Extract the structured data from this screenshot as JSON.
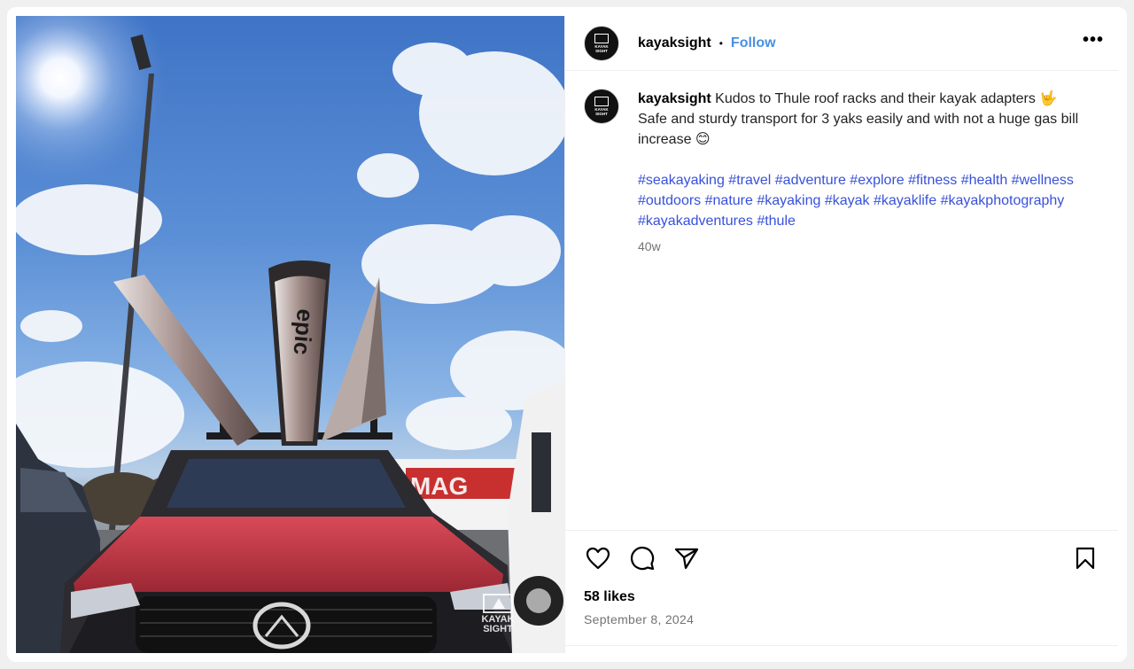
{
  "post": {
    "username": "kayaksight",
    "follow_label": "Follow",
    "more_label": "•••",
    "caption": "Kudos to Thule roof racks and their kayak adapters 🤟 Safe and sturdy transport for 3 yaks easily and with not a huge gas bill increase 😊",
    "hashtags": [
      "#seakayaking",
      "#travel",
      "#adventure",
      "#explore",
      "#fitness",
      "#health",
      "#wellness",
      "#outdoors",
      "#nature",
      "#kayaking",
      "#kayak",
      "#kayaklife",
      "#kayakphotography",
      "#kayakadventures",
      "#thule"
    ],
    "time_ago": "40w",
    "likes": "58 likes",
    "date": "September 8, 2024"
  },
  "photo": {
    "kayak_brand": "epic",
    "truck_text": "MAG",
    "watermark_line1": "KAYAK",
    "watermark_line2": "SIGHT"
  },
  "icons": {
    "like": "heart-icon",
    "comment": "comment-icon",
    "share": "send-icon",
    "save": "bookmark-icon",
    "more": "more-options-icon"
  },
  "colors": {
    "follow": "#4a90e2",
    "hashtag": "#3851d9",
    "meta": "#737373"
  }
}
